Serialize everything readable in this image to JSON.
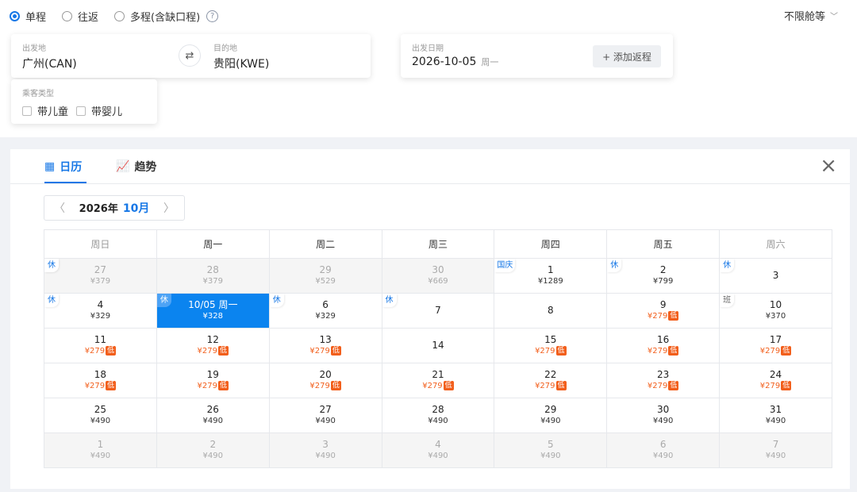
{
  "trip_types": [
    {
      "label": "单程",
      "selected": true
    },
    {
      "label": "往返",
      "selected": false
    },
    {
      "label": "多程(含缺口程)",
      "selected": false
    }
  ],
  "help_symbol": "?",
  "cabin": {
    "label": "不限舱等",
    "icon": "chevron-down-icon"
  },
  "route": {
    "from_label": "出发地",
    "from_value": "广州(CAN)",
    "to_label": "目的地",
    "to_value": "贵阳(KWE)",
    "swap_icon": "swap-icon"
  },
  "date": {
    "label": "出发日期",
    "value": "2026-10-05",
    "weekday": "周一",
    "add_return": "+ 添加返程"
  },
  "passenger": {
    "label": "乘客类型",
    "options": [
      "带儿童",
      "带婴儿"
    ]
  },
  "tabs": [
    {
      "label": "日历",
      "icon": "calendar-icon",
      "active": true
    },
    {
      "label": "趋势",
      "icon": "trend-icon",
      "active": false
    }
  ],
  "close_icon": "close-icon",
  "month_nav": {
    "year": "2026年",
    "month": "10月",
    "prev_icon": "chevron-left-icon",
    "next_icon": "chevron-right-icon"
  },
  "weekdays": [
    "周日",
    "周一",
    "周二",
    "周三",
    "周四",
    "周五",
    "周六"
  ],
  "weeks": [
    [
      {
        "day": "27",
        "price": "¥379",
        "dim": true,
        "tag": "休"
      },
      {
        "day": "28",
        "price": "¥379",
        "dim": true
      },
      {
        "day": "29",
        "price": "¥529",
        "dim": true
      },
      {
        "day": "30",
        "price": "¥669",
        "dim": true
      },
      {
        "day": "1",
        "price": "¥1289",
        "tag": "国庆"
      },
      {
        "day": "2",
        "price": "¥799",
        "tag": "休"
      },
      {
        "day": "3",
        "price": "",
        "tag": "休"
      }
    ],
    [
      {
        "day": "4",
        "price": "¥329",
        "tag": "休"
      },
      {
        "day": "10/05 周一",
        "price": "¥328",
        "selected": true,
        "tag": "休"
      },
      {
        "day": "6",
        "price": "¥329",
        "tag": "休"
      },
      {
        "day": "7",
        "price": "",
        "tag": "休"
      },
      {
        "day": "8",
        "price": ""
      },
      {
        "day": "9",
        "price": "¥279",
        "low": true
      },
      {
        "day": "10",
        "price": "¥370",
        "tag": "班"
      }
    ],
    [
      {
        "day": "11",
        "price": "¥279",
        "low": true
      },
      {
        "day": "12",
        "price": "¥279",
        "low": true
      },
      {
        "day": "13",
        "price": "¥279",
        "low": true
      },
      {
        "day": "14",
        "price": ""
      },
      {
        "day": "15",
        "price": "¥279",
        "low": true
      },
      {
        "day": "16",
        "price": "¥279",
        "low": true
      },
      {
        "day": "17",
        "price": "¥279",
        "low": true
      }
    ],
    [
      {
        "day": "18",
        "price": "¥279",
        "low": true
      },
      {
        "day": "19",
        "price": "¥279",
        "low": true
      },
      {
        "day": "20",
        "price": "¥279",
        "low": true
      },
      {
        "day": "21",
        "price": "¥279",
        "low": true
      },
      {
        "day": "22",
        "price": "¥279",
        "low": true
      },
      {
        "day": "23",
        "price": "¥279",
        "low": true
      },
      {
        "day": "24",
        "price": "¥279",
        "low": true
      }
    ],
    [
      {
        "day": "25",
        "price": "¥490"
      },
      {
        "day": "26",
        "price": "¥490"
      },
      {
        "day": "27",
        "price": "¥490"
      },
      {
        "day": "28",
        "price": "¥490"
      },
      {
        "day": "29",
        "price": "¥490"
      },
      {
        "day": "30",
        "price": "¥490"
      },
      {
        "day": "31",
        "price": "¥490"
      }
    ],
    [
      {
        "day": "1",
        "price": "¥490",
        "dim": true
      },
      {
        "day": "2",
        "price": "¥490",
        "dim": true
      },
      {
        "day": "3",
        "price": "¥490",
        "dim": true
      },
      {
        "day": "4",
        "price": "¥490",
        "dim": true
      },
      {
        "day": "5",
        "price": "¥490",
        "dim": true
      },
      {
        "day": "6",
        "price": "¥490",
        "dim": true
      },
      {
        "day": "7",
        "price": "¥490",
        "dim": true
      }
    ]
  ],
  "low_badge": "低",
  "colors": {
    "accent": "#1677e6",
    "selected_bg": "#0b84ef",
    "low_price": "#f25f1c"
  }
}
